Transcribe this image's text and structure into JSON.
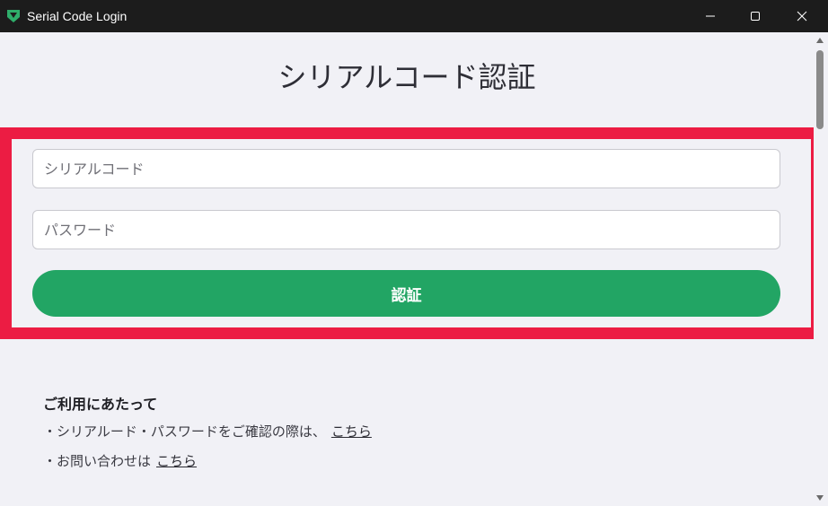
{
  "window": {
    "title": "Serial Code Login",
    "icon": "app-logo-icon",
    "controls": [
      "minimize-icon",
      "maximize-icon",
      "close-icon"
    ]
  },
  "main": {
    "heading": "シリアルコード認証",
    "serial_field": {
      "placeholder": "シリアルコード",
      "value": ""
    },
    "password_field": {
      "placeholder": "パスワード",
      "value": ""
    },
    "submit_label": "認証"
  },
  "notes": {
    "title": "ご利用にあたって",
    "items": [
      {
        "text": "・シリアルード・パスワードをご確認の際は、",
        "link": "こちら"
      },
      {
        "text": "・お問い合わせは",
        "link": "こちら"
      }
    ]
  },
  "colors": {
    "accent": "#22a564",
    "highlight": "#ec1c43",
    "titlebar": "#1c1c1c",
    "background": "#f1f1f6"
  }
}
